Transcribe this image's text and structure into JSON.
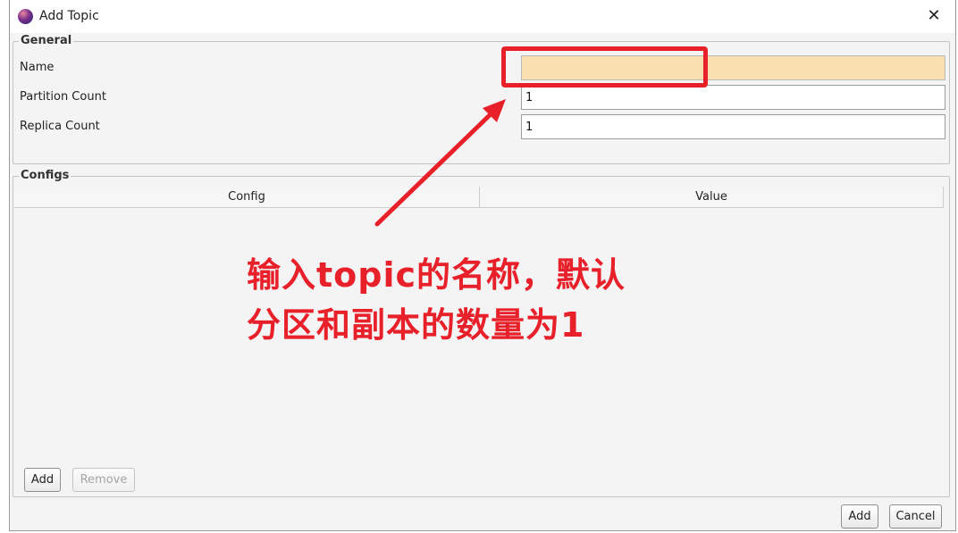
{
  "window": {
    "title": "Add Topic"
  },
  "general": {
    "legend": "General",
    "fields": {
      "name": {
        "label": "Name",
        "value": ""
      },
      "partition_count": {
        "label": "Partition Count",
        "value": "1"
      },
      "replica_count": {
        "label": "Replica Count",
        "value": "1"
      }
    }
  },
  "configs": {
    "legend": "Configs",
    "columns": [
      "Config",
      "Value"
    ],
    "add_label": "Add",
    "remove_label": "Remove"
  },
  "footer": {
    "add_label": "Add",
    "cancel_label": "Cancel"
  },
  "annotation": {
    "line1": "输入topic的名称，默认",
    "line2": "分区和副本的数量为1"
  },
  "colors": {
    "accent_red": "#e8202a",
    "focused_field": "#f8dfb0"
  },
  "icons": {
    "app": "app-logo-icon",
    "close": "close-icon"
  }
}
